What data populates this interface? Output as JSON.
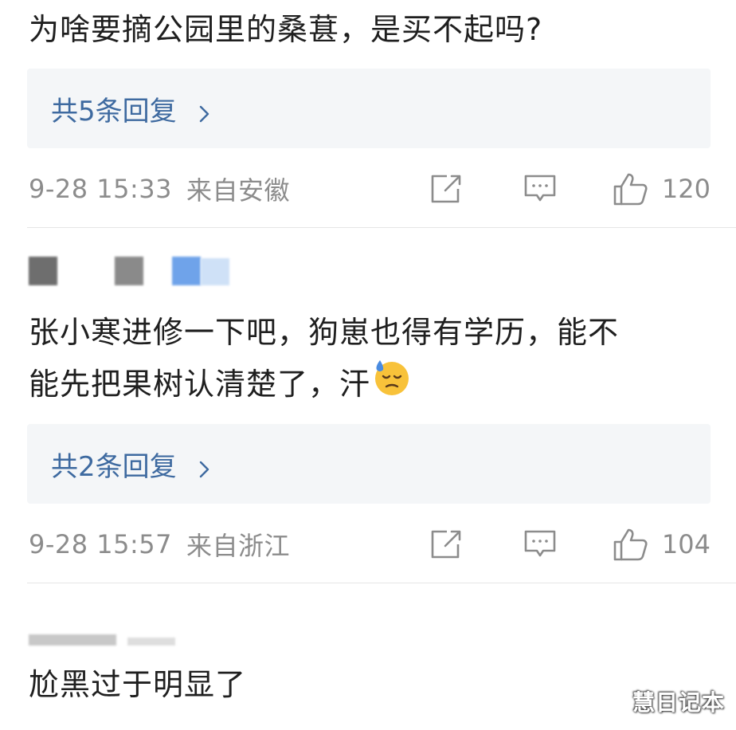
{
  "comments": [
    {
      "text_lines": [
        "为啥要摘公园里的桑葚，是买不起吗?"
      ],
      "replies_label": "共5条回复",
      "timestamp": "9-28 15:33",
      "location": "来自安徽",
      "likes": "120"
    },
    {
      "text_lines": [
        "张小寒进修一下吧，狗崽也得有学历，能不",
        "能先把果树认清楚了，汗"
      ],
      "emoji": "downcast-sweat-emoji",
      "replies_label": "共2条回复",
      "timestamp": "9-28 15:57",
      "location": "来自浙江",
      "likes": "104"
    },
    {
      "text_lines": [
        "尬黑过于明显了"
      ]
    }
  ],
  "icons": {
    "share": "share-icon",
    "comment": "comment-icon",
    "like": "thumbs-up-icon",
    "chevron": "chevron-right-icon"
  },
  "colors": {
    "link": "#3e6aa0",
    "meta": "#8c8c8c",
    "reply_bg": "#f4f6f8"
  },
  "watermark": "慧日记本"
}
